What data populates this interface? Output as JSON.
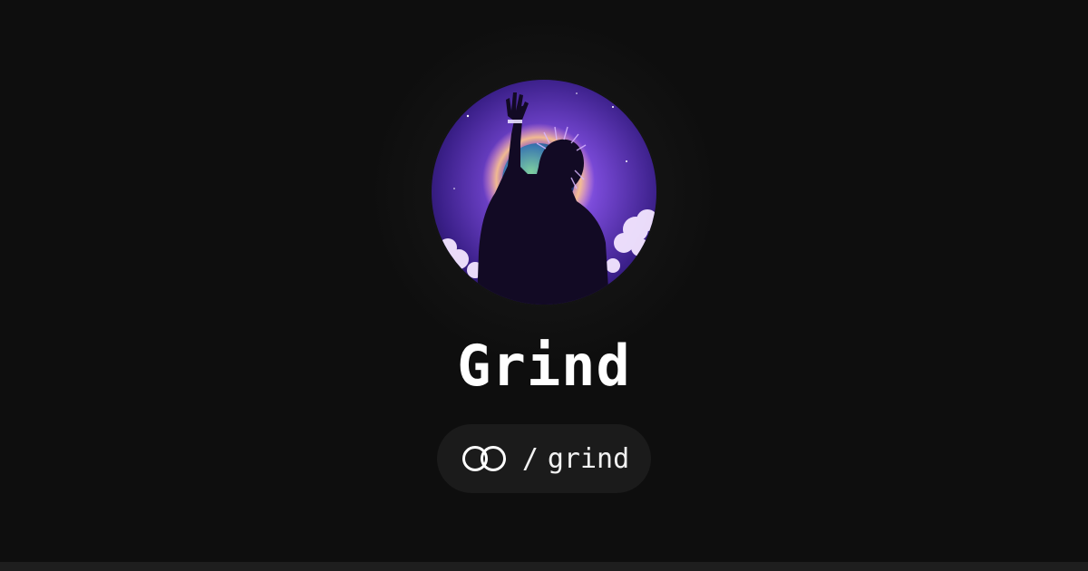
{
  "profile": {
    "name": "Grind",
    "handle_separator": "/",
    "handle": "grind",
    "avatar_icon": "silhouette-avatar",
    "link_icon": "linked-rings-icon"
  },
  "colors": {
    "background": "#0e0e0e",
    "pill_background": "#1b1b1b",
    "text": "#ffffff",
    "avatar_purple": "#6a3fd0",
    "bottom_bar": "#1e1e1e"
  }
}
